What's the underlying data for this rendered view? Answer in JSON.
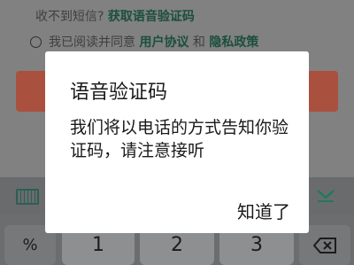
{
  "background": {
    "sms_prompt": "收不到短信?",
    "sms_link": "获取语音验证码",
    "agree_prefix": "我已阅读并同意",
    "agree_user": "用户协议",
    "agree_and": "和",
    "agree_privacy": "隐私政策"
  },
  "keyboard": {
    "toolbar_left_icon": "keyboard-icon",
    "toolbar_right_icon": "collapse-down-icon",
    "keys": [
      "%",
      "1",
      "2",
      "3"
    ],
    "backspace_icon": "backspace-icon"
  },
  "dialog": {
    "title": "语音验证码",
    "message": "我们将以电话的方式告知你验证码，请注意接听",
    "confirm_label": "知道了"
  },
  "colors": {
    "accent": "#1b4f3d",
    "primary_button": "#a9503f"
  }
}
